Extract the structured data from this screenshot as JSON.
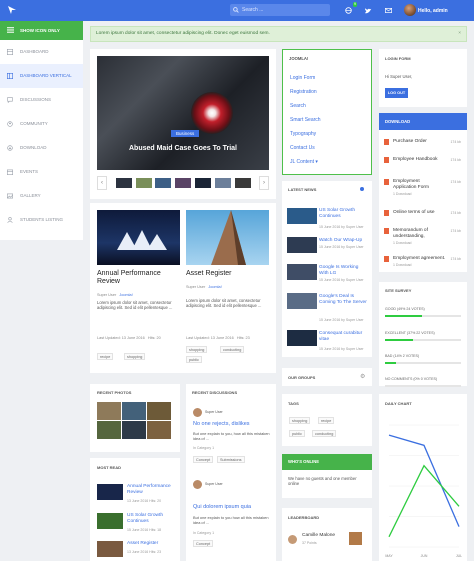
{
  "topbar": {
    "search_placeholder": "Search ...",
    "notif_count": "9",
    "user_greeting": "Hello, admin"
  },
  "sidebar": {
    "show_icon_only": "SHOW ICON ONLY",
    "items": [
      {
        "label": "Dashboard",
        "icon": "dashboard-icon"
      },
      {
        "label": "Dashboard Vertical",
        "icon": "dashboard-icon",
        "active": true
      },
      {
        "label": "Discussions",
        "icon": "chat-icon"
      },
      {
        "label": "Community",
        "icon": "community-icon"
      },
      {
        "label": "Download",
        "icon": "download-icon"
      },
      {
        "label": "Events",
        "icon": "calendar-icon"
      },
      {
        "label": "Gallery",
        "icon": "image-icon"
      },
      {
        "label": "Students Listing",
        "icon": "user-icon"
      }
    ]
  },
  "alert": {
    "text": "Lorem ipsum dolor sit amet, consectetur adipiscing elit. Donec eget euismod sem.",
    "close": "×"
  },
  "hero": {
    "tag": "Business",
    "title": "Abused Maid Case Goes To Trial",
    "prev": "‹",
    "next": "›"
  },
  "posts": [
    {
      "title": "Annual Performance Review",
      "author": "Super User",
      "category": "Joomla!",
      "excerpt": "Lorem ipsum dolor sit amet, consectetur adipiscing elit. Sed id elit pellentesque ...",
      "updated": "Last Updated: 13 June 2016",
      "hits": "Hits: 20",
      "tags": [
        "recipe",
        "shopping"
      ]
    },
    {
      "title": "Asset Register",
      "author": "Super User",
      "category": "Joomla!",
      "excerpt": "Lorem ipsum dolor sit amet, consectetur adipiscing elit. Sed id elit pellentesque ...",
      "updated": "Last Updated: 13 June 2016",
      "hits": "Hits: 23",
      "tags": [
        "shopping",
        "conducting",
        "public"
      ]
    }
  ],
  "joomla_menu": {
    "heading": "JOOMLA!",
    "items": [
      "Login Form",
      "Registration",
      "Search",
      "Smart Search",
      "Typography",
      "Contact Us",
      "JL Content"
    ]
  },
  "latest_news": {
    "heading": "LATEST NEWS",
    "items": [
      {
        "title": "US Solar Growth Continues",
        "meta": "15 June 2016  by Super User"
      },
      {
        "title": "Watch Our Wrap-Up",
        "meta": "15 June 2016  by Super User"
      },
      {
        "title": "Google Is Working With LG",
        "meta": "15 June 2016  by Super User"
      },
      {
        "title": "Google's Deal Is Coming To The Server",
        "meta": "15 June 2016  by Super User"
      },
      {
        "title": "Consequat curabitur vitae",
        "meta": "15 June 2016  by Super User"
      }
    ]
  },
  "our_groups": {
    "heading": "OUR GROUPS"
  },
  "tags_module": {
    "heading": "TAGS",
    "tags": [
      "shopping",
      "recipe",
      "public",
      "conducting"
    ]
  },
  "whos_online": {
    "heading": "WHO'S ONLINE",
    "text": "We have no guests and one member online"
  },
  "leaderboard": {
    "heading": "LEADERBOARD",
    "name": "Camille Malone",
    "points": "37 Points"
  },
  "recent_photos": {
    "heading": "RECENT PHOTOS"
  },
  "most_read": {
    "heading": "MOST READ",
    "items": [
      {
        "title": "Annual Performance Review",
        "meta": "13 June 2016  Hits: 20"
      },
      {
        "title": "US Solar Growth Continues",
        "meta": "15 June 2016  Hits: 18"
      },
      {
        "title": "Asset Register",
        "meta": "13 June 2016  Hits: 23"
      }
    ]
  },
  "recent_discussions": {
    "heading": "RECENT DISCUSSIONS",
    "items": [
      {
        "author": "Super User",
        "title": "No one rejects, dislikes",
        "excerpt": "But one explain to you, how all this mistaken idea of ...",
        "category": "In Category 1",
        "tags": [
          "Concept",
          "Submissions"
        ]
      },
      {
        "author": "Super User",
        "title": "Qui dolorem ipsum quia",
        "excerpt": "But one explain to you how all this mistaken idea of ...",
        "category": "In Category 1",
        "tags": [
          "Concept"
        ]
      }
    ]
  },
  "login": {
    "heading": "LOGIN FORM",
    "greeting": "Hi Super User,",
    "button": "LOG OUT"
  },
  "downloads": {
    "heading": "DOWNLOAD",
    "items": [
      {
        "title": "Purchase Order",
        "size": "174 kb",
        "sub": ""
      },
      {
        "title": "Employee Handbook",
        "size": "174 kb",
        "sub": ""
      },
      {
        "title": "Employment Application Form",
        "size": "174 kb",
        "sub": "1 Download"
      },
      {
        "title": "Online terms of use",
        "size": "174 kb",
        "sub": ""
      },
      {
        "title": "Memorandum of understanding,",
        "size": "174 kb",
        "sub": "1 Download"
      },
      {
        "title": "Employment agreement.",
        "size": "174 kb",
        "sub": "1 Download"
      }
    ]
  },
  "survey": {
    "heading": "SITE SURVEY",
    "options": [
      {
        "label": "GOOD (49% 24 VOTES)",
        "pct": 49
      },
      {
        "label": "EXCELLENT (37% 22 VOTES)",
        "pct": 37
      },
      {
        "label": "BAD (14% 2 VOTES)",
        "pct": 14
      },
      {
        "label": "NO COMMENTS (0% 0 VOTES)",
        "pct": 0
      }
    ]
  },
  "chart_data": {
    "type": "line",
    "title": "DAILY CHART",
    "categories": [
      "MAY",
      "JUN",
      "JUL"
    ],
    "series": [
      {
        "color": "#3b6fe0",
        "values": [
          55,
          50,
          10
        ]
      },
      {
        "color": "#2ecc40",
        "values": [
          5,
          40,
          20
        ]
      }
    ],
    "ylim": [
      0,
      60
    ]
  },
  "colors": {
    "primary": "#3b6fe0",
    "success": "#46b34a"
  }
}
